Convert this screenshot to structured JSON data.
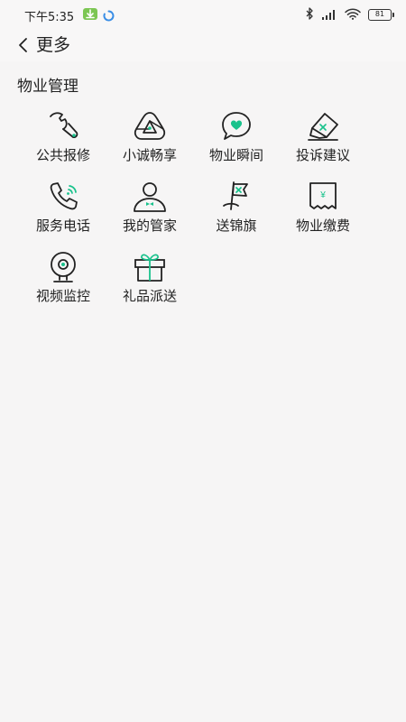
{
  "status": {
    "time": "下午5:35",
    "battery": "81",
    "icons": [
      "download-icon",
      "loading-icon",
      "bluetooth-icon",
      "signal-icon",
      "wifi-icon",
      "battery-icon"
    ]
  },
  "nav": {
    "back_icon": "chevron-left-icon",
    "title": "更多"
  },
  "section": {
    "title": "物业管理"
  },
  "colors": {
    "accent": "#19c28c",
    "icon_stroke": "#222222",
    "background": "#f6f5f5"
  },
  "grid": {
    "items": [
      {
        "label": "公共报修",
        "icon": "wrench-icon"
      },
      {
        "label": "小诚畅享",
        "icon": "triangle-share-icon"
      },
      {
        "label": "物业瞬间",
        "icon": "chat-heart-icon"
      },
      {
        "label": "投诉建议",
        "icon": "eraser-icon"
      },
      {
        "label": "服务电话",
        "icon": "phone-icon"
      },
      {
        "label": "我的管家",
        "icon": "butler-icon"
      },
      {
        "label": "送锦旗",
        "icon": "flag-icon"
      },
      {
        "label": "物业缴费",
        "icon": "bill-icon"
      },
      {
        "label": "视频监控",
        "icon": "camera-icon"
      },
      {
        "label": "礼品派送",
        "icon": "gift-icon"
      }
    ]
  }
}
